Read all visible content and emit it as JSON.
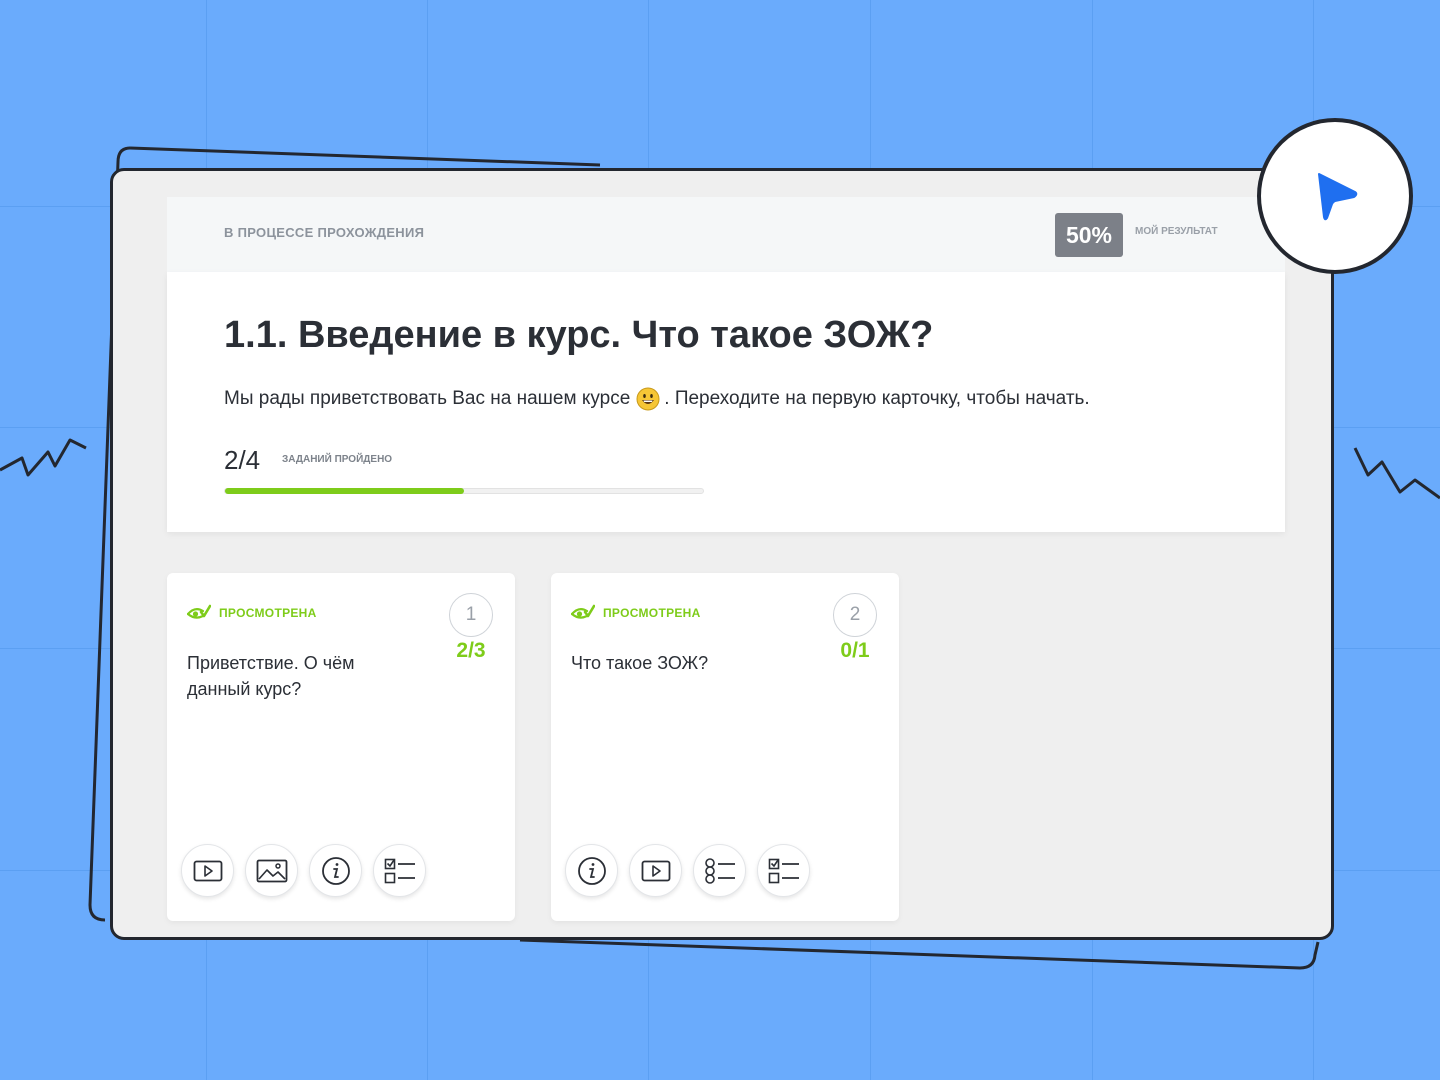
{
  "status": {
    "text": "В ПРОЦЕССЕ ПРОХОЖДЕНИЯ",
    "result_percent": "50%",
    "result_label": "МОЙ РЕЗУЛЬТАТ"
  },
  "lesson": {
    "title": "1.1. Введение в курс. Что такое ЗОЖ?",
    "description_before": "Мы рады приветствовать Вас на нашем курсе",
    "description_after": ". Переходите на первую карточку, чтобы начать.",
    "progress_count": "2/4",
    "progress_label": "ЗАДАНИЙ ПРОЙДЕНО",
    "progress_fraction": 0.5
  },
  "cards": [
    {
      "status": "ПРОСМОТРЕНА",
      "number": "1",
      "score": "2/3",
      "title": "Приветствие. О чём данный курс?",
      "icons": [
        "video-icon",
        "image-icon",
        "info-icon",
        "checklist-icon"
      ]
    },
    {
      "status": "ПРОСМОТРЕНА",
      "number": "2",
      "score": "0/1",
      "title": "Что такое ЗОЖ?",
      "icons": [
        "info-icon",
        "video-icon",
        "options-list-icon",
        "checklist-icon"
      ]
    }
  ],
  "colors": {
    "background": "#6aabfc",
    "accent_green": "#7ecc1a",
    "badge_gray": "#7c8088",
    "play_blue": "#1f6ff0",
    "outline": "#23272f"
  }
}
